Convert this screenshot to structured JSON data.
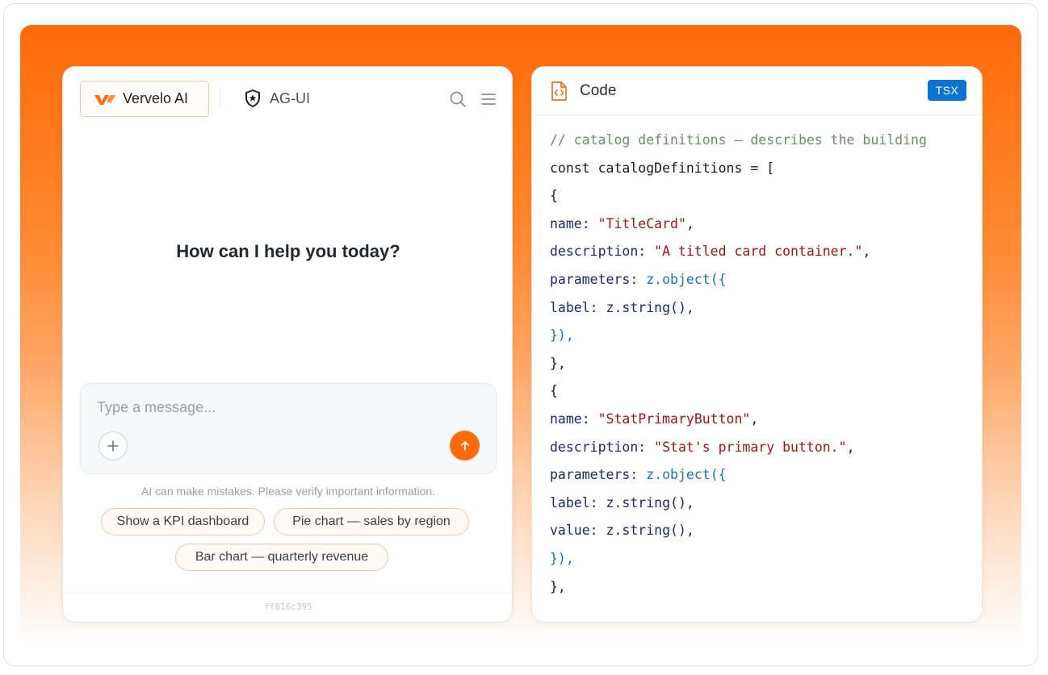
{
  "colors": {
    "accent": "#ff6a0a",
    "badge": "#0b73d4",
    "code_comment": "#6a8f6a",
    "code_key": "#1a2a6e",
    "code_string": "#a31515",
    "code_function": "#1b73b6"
  },
  "chat": {
    "brand": {
      "name": "Vervelo AI",
      "logo_icon": "vervelo-logo-icon"
    },
    "protocol": {
      "name": "AG-UI",
      "icon": "shield-star-icon"
    },
    "header_icons": [
      "search-icon",
      "menu-icon"
    ],
    "greeting": "How can I help you today?",
    "composer": {
      "placeholder": "Type a message...",
      "value": "",
      "attach_icon": "plus-icon",
      "send_icon": "arrow-up-icon"
    },
    "disclaimer": "AI can make mistakes. Please verify important information.",
    "suggestions": [
      "Show a KPI dashboard",
      "Pie chart — sales by region",
      "Bar chart — quarterly revenue"
    ],
    "build_hash": "ff816c395"
  },
  "code": {
    "title": "Code",
    "file_icon": "code-file-icon",
    "language": "TSX",
    "lines": [
      [
        {
          "t": "// catalog definitions — describes the building",
          "k": "comment"
        }
      ],
      [
        {
          "t": "const catalogDefinitions = [",
          "k": "plain"
        }
      ],
      [
        {
          "t": "{",
          "k": "plain"
        }
      ],
      [
        {
          "t": "name: ",
          "k": "key"
        },
        {
          "t": "\"TitleCard\"",
          "k": "str"
        },
        {
          "t": ",",
          "k": "plain"
        }
      ],
      [
        {
          "t": "description: ",
          "k": "key"
        },
        {
          "t": "\"A titled card container.\"",
          "k": "str"
        },
        {
          "t": ",",
          "k": "plain"
        }
      ],
      [
        {
          "t": "parameters: ",
          "k": "key"
        },
        {
          "t": "z.object({",
          "k": "fn"
        }
      ],
      [
        {
          "t": "label: ",
          "k": "key"
        },
        {
          "t": "z.string(),",
          "k": "key"
        }
      ],
      [
        {
          "t": "}),",
          "k": "fn"
        }
      ],
      [
        {
          "t": "},",
          "k": "plain"
        }
      ],
      [
        {
          "t": "{",
          "k": "plain"
        }
      ],
      [
        {
          "t": "name: ",
          "k": "key"
        },
        {
          "t": "\"StatPrimaryButton\"",
          "k": "str"
        },
        {
          "t": ",",
          "k": "plain"
        }
      ],
      [
        {
          "t": "description: ",
          "k": "key"
        },
        {
          "t": "\"Stat's primary button.\"",
          "k": "str"
        },
        {
          "t": ",",
          "k": "plain"
        }
      ],
      [
        {
          "t": "parameters: ",
          "k": "key"
        },
        {
          "t": "z.object({",
          "k": "fn"
        }
      ],
      [
        {
          "t": "label: ",
          "k": "key"
        },
        {
          "t": "z.string(),",
          "k": "key"
        }
      ],
      [
        {
          "t": "value: ",
          "k": "key"
        },
        {
          "t": "z.string(),",
          "k": "key"
        }
      ],
      [
        {
          "t": "}),",
          "k": "fn"
        }
      ],
      [
        {
          "t": "},",
          "k": "plain"
        }
      ]
    ]
  }
}
